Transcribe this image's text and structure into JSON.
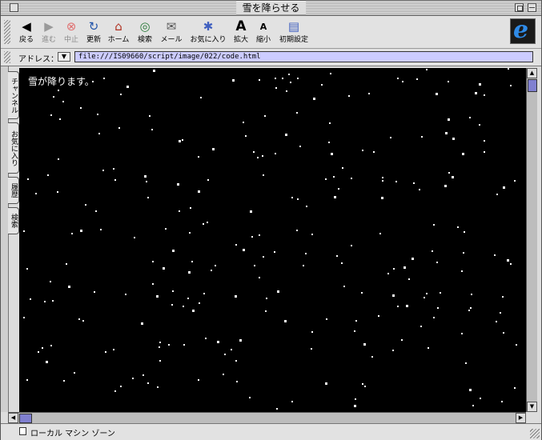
{
  "window": {
    "title": "雪を降らせる"
  },
  "toolbar": {
    "buttons": [
      {
        "label": "戻る",
        "icon": "◀",
        "disabled": false
      },
      {
        "label": "進む",
        "icon": "▶",
        "disabled": true
      },
      {
        "label": "中止",
        "icon": "⊗",
        "disabled": true
      },
      {
        "label": "更新",
        "icon": "↻",
        "disabled": false
      },
      {
        "label": "ホーム",
        "icon": "⌂",
        "disabled": false
      },
      {
        "label": "検索",
        "icon": "◎",
        "disabled": false
      },
      {
        "label": "メール",
        "icon": "✉",
        "disabled": false
      },
      {
        "label": "お気に入り",
        "icon": "✱",
        "disabled": false
      },
      {
        "label": "拡大",
        "icon": "A",
        "disabled": false
      },
      {
        "label": "縮小",
        "icon": "A",
        "disabled": false
      },
      {
        "label": "初期設定",
        "icon": "▤",
        "disabled": false
      }
    ],
    "logo_letter": "e"
  },
  "address": {
    "label": "アドレス：",
    "value": "file:///IS09660/script/image/022/code.html"
  },
  "sidetabs": [
    "チャンネル",
    "お気に入り",
    "履歴",
    "検索"
  ],
  "content": {
    "text": "雪が降ります。",
    "flake_count": 260
  },
  "status": {
    "text": "ローカル マシン ゾーン"
  },
  "colors": {
    "background": "#000000",
    "snow": "#ffffff",
    "address_field": "#ccccff",
    "scroll_thumb": "#8080d0"
  }
}
